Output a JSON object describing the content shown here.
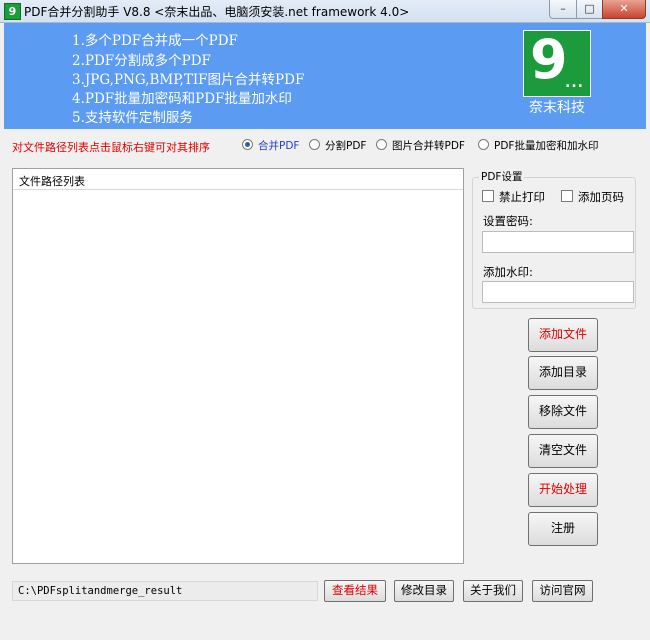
{
  "window": {
    "app_icon_glyph": "9",
    "title": "PDF合并分割助手 V8.8 <奈末出品、电脑须安装.net framework 4.0>",
    "controls": {
      "minimize": "–",
      "maximize": "□",
      "close": "✕"
    }
  },
  "banner": {
    "features": [
      "1.多个PDF合并成一个PDF",
      "2.PDF分割成多个PDF",
      "3.JPG,PNG,BMP,TIF图片合并转PDF",
      "4.PDF批量加密码和PDF批量加水印",
      "5.支持软件定制服务"
    ],
    "logo_glyph": "9",
    "logo_dots": "...",
    "logo_text": "奈末科技"
  },
  "hint": "对文件路径列表点击鼠标右键可对其排序",
  "modes": [
    {
      "label": "合并PDF",
      "selected": true
    },
    {
      "label": "分割PDF",
      "selected": false
    },
    {
      "label": "图片合并转PDF",
      "selected": false
    },
    {
      "label": "PDF批量加密和加水印",
      "selected": false
    }
  ],
  "file_list": {
    "header": "文件路径列表",
    "items": []
  },
  "pdf_settings": {
    "title": "PDF设置",
    "disable_print": "禁止打印",
    "add_page_number": "添加页码",
    "password_label": "设置密码:",
    "password_value": "",
    "watermark_label": "添加水印:",
    "watermark_value": ""
  },
  "buttons": {
    "add_file": "添加文件",
    "add_folder": "添加目录",
    "remove_file": "移除文件",
    "clear_files": "清空文件",
    "start": "开始处理",
    "register": "注册"
  },
  "footer": {
    "output_path": "C:\\PDFsplitandmerge_result",
    "view_result": "查看结果",
    "change_folder": "修改目录",
    "about": "关于我们",
    "website": "访问官网"
  },
  "colors": {
    "banner": "#5b9bf1",
    "logo": "#1b9b3c",
    "accent_red": "#e00000",
    "selected_radio_text": "#1f3fd0"
  }
}
